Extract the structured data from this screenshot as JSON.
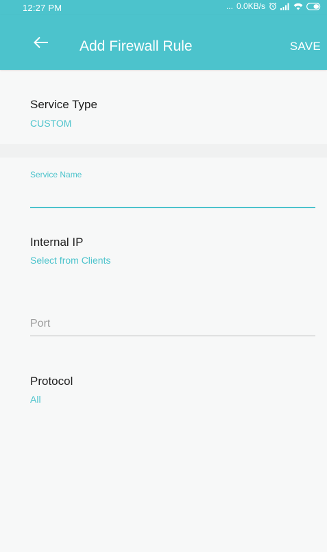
{
  "status_bar": {
    "time": "12:27 PM",
    "dots": "...",
    "net_speed": "0.0KB/s",
    "icons": [
      "alarm-icon",
      "signal-icon",
      "wifi-icon",
      "battery-icon"
    ]
  },
  "app_bar": {
    "back_icon": "arrow-left-icon",
    "title": "Add Firewall Rule",
    "save_label": "SAVE"
  },
  "service_type": {
    "label": "Service Type",
    "value": "CUSTOM"
  },
  "service_name": {
    "label": "Service Name",
    "value": ""
  },
  "internal_ip": {
    "label": "Internal IP",
    "value": "Select from Clients"
  },
  "port": {
    "placeholder": "Port",
    "value": ""
  },
  "protocol": {
    "label": "Protocol",
    "value": "All"
  },
  "colors": {
    "accent": "#4cc3cc",
    "background": "#f7f8f8",
    "text": "#1e1e1e"
  }
}
